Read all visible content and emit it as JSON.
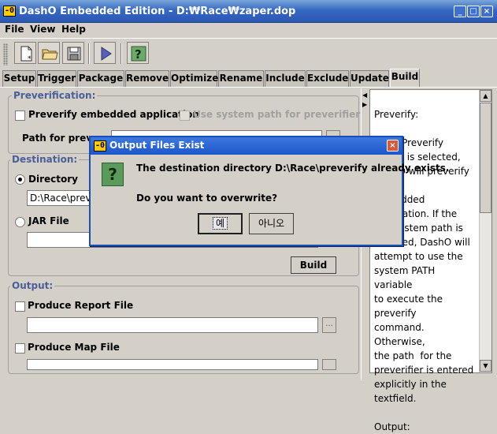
{
  "window": {
    "title": "DashO Embedded Edition - D:₩Race₩zaper.dop",
    "logo": "-0",
    "buttons": [
      "_",
      "□",
      "×"
    ]
  },
  "menubar": {
    "items": [
      "File",
      "View",
      "Help"
    ]
  },
  "toolbar": {
    "icons": [
      "new-document-icon",
      "open-folder-icon",
      "save-disk-icon",
      "run-play-icon",
      "help-question-icon"
    ]
  },
  "tabs": {
    "items": [
      "Setup",
      "Trigger",
      "Package",
      "Remove",
      "Optimize",
      "Rename",
      "Include",
      "Exclude",
      "Update",
      "Build"
    ],
    "active": "Build"
  },
  "preverification": {
    "title": "Preverification:",
    "embedded_label": "Preverify embedded application",
    "system_path_label": "Use system path for preverifier",
    "path_label": "Path for prever"
  },
  "destination": {
    "title": "Destination:",
    "directory_label": "Directory",
    "directory_value": "D:\\Race\\preve",
    "jar_label": "JAR File",
    "jar_value": "",
    "build_label": "Build"
  },
  "output": {
    "title": "Output:",
    "report_label": "Produce Report File",
    "map_label": "Produce Map File",
    "dots": "..."
  },
  "help_panel": {
    "text": "Preverify:\n\nIf the Preverify option is selected, DashO will preverify the\nembedded\napplication. If the use system path is\nselected, DashO will\nattempt to use the\nsystem PATH variable\nto execute the preverify\ncommand. Otherwise,\nthe path  for the\npreverifier is entered\nexplicitly in the textfield.\n\nOutput:"
  },
  "dialog": {
    "title": "Output Files Exist",
    "logo": "-0",
    "icon_glyph": "?",
    "message": "The destination directory D:\\Race\\preverify already exists.",
    "question": "Do you want to overwrite?",
    "yes_label": "예",
    "no_label": "아니오",
    "close_glyph": "×"
  },
  "colors": {
    "titlebar": "#2a58b5",
    "group_title": "#4a5e9a",
    "dialog_border": "#1c4fb5",
    "background": "#d4d0c8"
  }
}
